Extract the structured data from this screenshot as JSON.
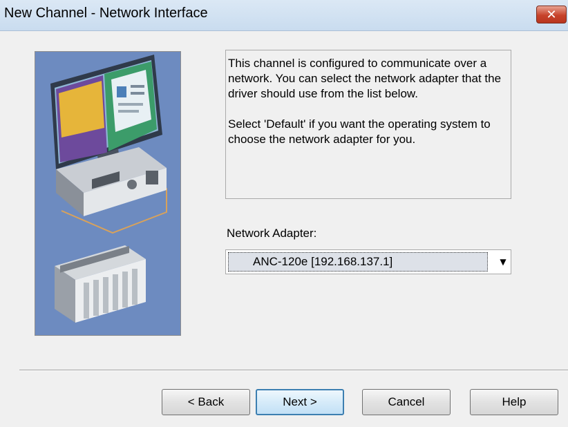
{
  "window": {
    "title": "New Channel - Network Interface",
    "close_glyph": "✕"
  },
  "info": {
    "paragraph1": "This channel is configured to communicate over a network.  You can select the network adapter that the driver should use from the list below.",
    "paragraph2": "Select 'Default' if you want the operating system to choose the network adapter for you."
  },
  "adapter": {
    "label": "Network Adapter:",
    "selected_value": "ANC-120e  [192.168.137.1]",
    "dropdown_glyph": "▼"
  },
  "buttons": {
    "back": "< Back",
    "next": "Next >",
    "cancel": "Cancel",
    "help": "Help"
  },
  "illustration": {
    "description_icon": "computer-plc-network-illustration"
  },
  "colors": {
    "close_button": "#c7432a",
    "illustration_background": "#6d8bc0",
    "default_button_border": "#3c7fb1"
  }
}
